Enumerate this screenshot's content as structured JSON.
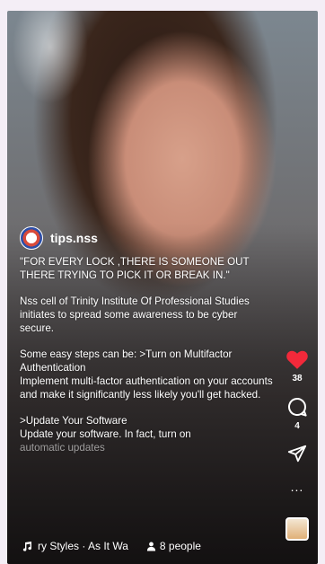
{
  "post": {
    "handle": "tips.nss",
    "caption": {
      "quote": "\"FOR EVERY LOCK ,THERE IS SOMEONE OUT THERE TRYING TO PICK IT OR BREAK IN.\"",
      "intro": "Nss cell of Trinity Institute Of Professional Studies initiates to spread some awareness to be cyber secure.",
      "steps_header": "Some easy steps can be: >Turn on Multifactor Authentication",
      "step1": "Implement multi-factor authentication on your accounts and make it significantly less likely you'll get hacked.",
      "step2_title": ">Update Your Software",
      "step2_body": "Update your software. In fact, turn on",
      "step2_fade": "automatic updates"
    }
  },
  "actions": {
    "likes": "38",
    "comments": "4",
    "more": "..."
  },
  "audio": {
    "label": "ry Styles · As It Wa",
    "people": "8 people"
  },
  "icons": {
    "like": "heart-icon",
    "comment": "comment-icon",
    "share": "send-icon",
    "music": "music-note-icon",
    "people": "person-icon"
  },
  "colors": {
    "like": "#f2293a"
  }
}
